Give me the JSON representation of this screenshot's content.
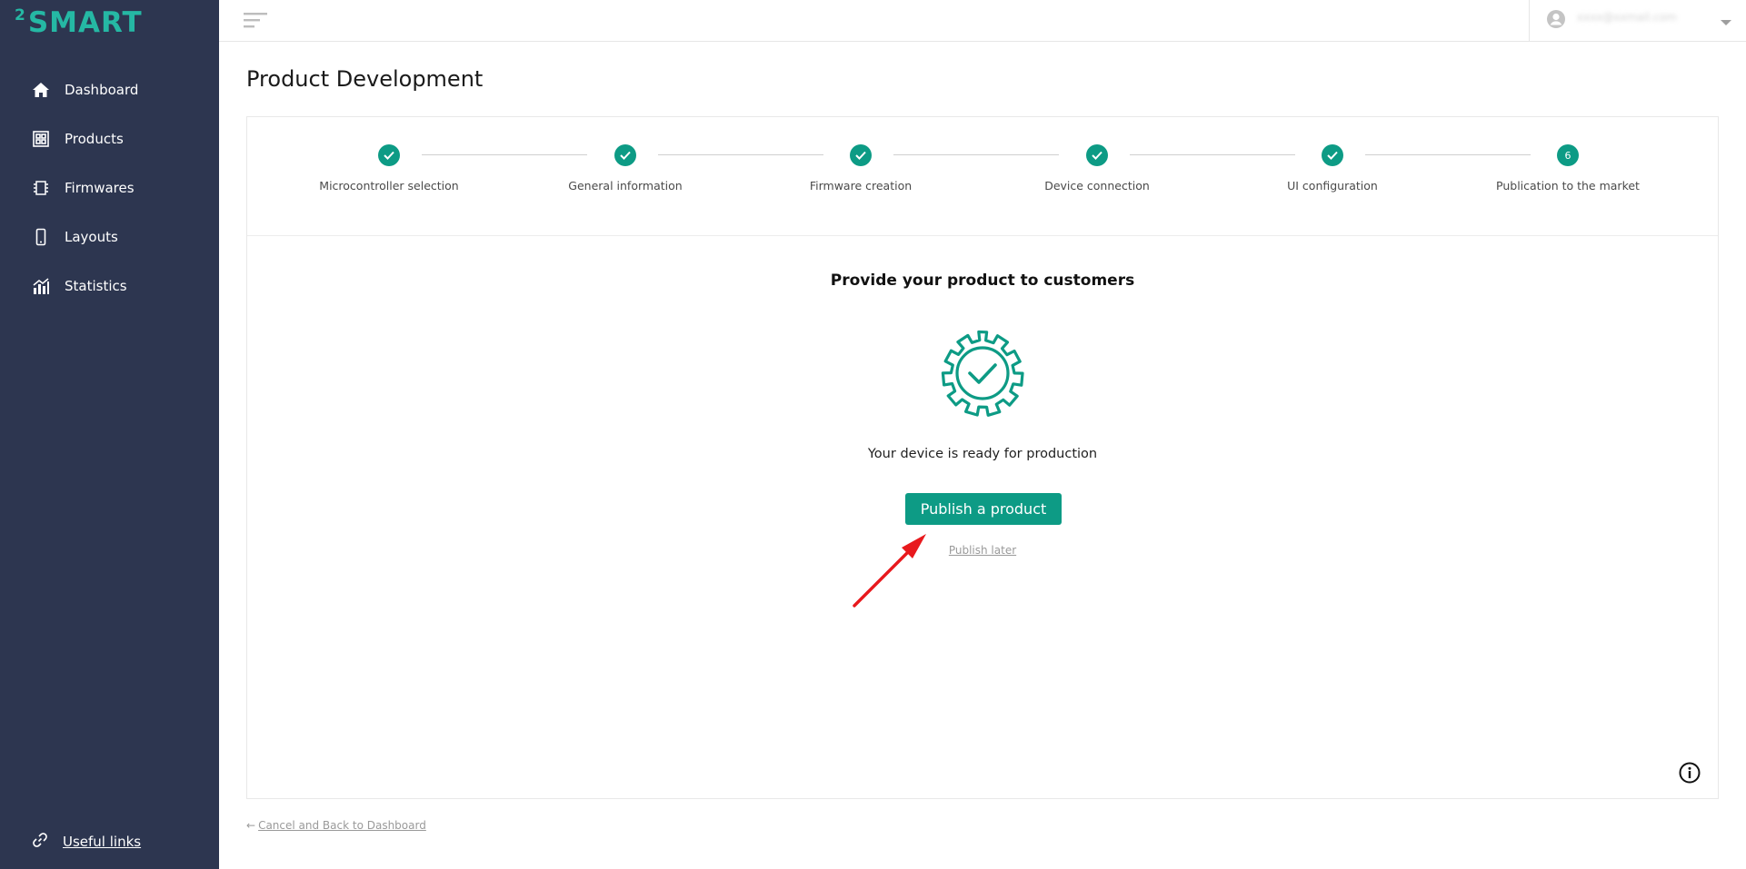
{
  "brand": {
    "sup": "2",
    "word": "SMART",
    "color": "#25b8a4"
  },
  "sidebar": {
    "items": [
      {
        "label": "Dashboard",
        "icon": "home-icon"
      },
      {
        "label": "Products",
        "icon": "products-icon"
      },
      {
        "label": "Firmwares",
        "icon": "chip-icon"
      },
      {
        "label": "Layouts",
        "icon": "phone-icon"
      },
      {
        "label": "Statistics",
        "icon": "statistics-icon"
      }
    ],
    "useful_links": "Useful links"
  },
  "topbar": {
    "user_email": "xxxx@xxmail.com"
  },
  "page": {
    "title": "Product Development"
  },
  "stepper": {
    "steps": [
      {
        "name": "Microcontroller selection",
        "state": "done"
      },
      {
        "name": "General information",
        "state": "done"
      },
      {
        "name": "Firmware creation",
        "state": "done"
      },
      {
        "name": "Device connection",
        "state": "done"
      },
      {
        "name": "UI configuration",
        "state": "done"
      },
      {
        "name": "Publication to the market",
        "state": "current",
        "number": "6"
      }
    ]
  },
  "content": {
    "heading": "Provide your product to customers",
    "ready_text": "Your device is ready for production",
    "publish_button": "Publish a product",
    "publish_later": "Publish later"
  },
  "footer": {
    "back_arrow": "←",
    "back_link": "Cancel and Back to Dashboard"
  },
  "colors": {
    "sidebar_bg": "#2d3650",
    "accent": "#0d9b85",
    "annotation_arrow": "#e8191d"
  }
}
